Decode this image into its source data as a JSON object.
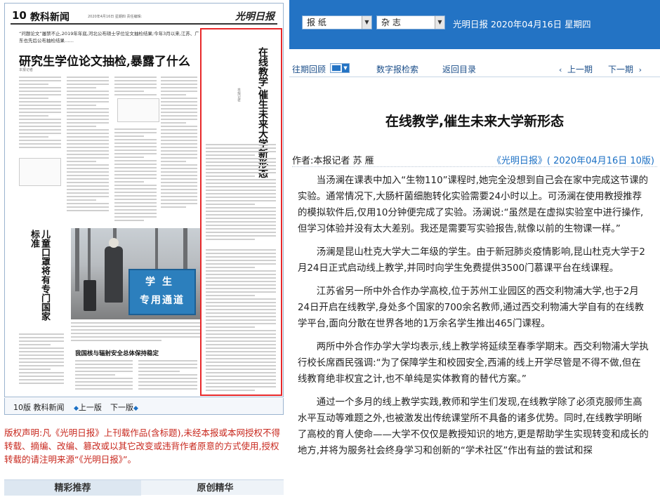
{
  "newspaper": {
    "page_number": "10",
    "section": "教科新闻",
    "date_line": "2020年4月16日 星期四 责任编辑:",
    "logo": "光明日报",
    "lead_text": "“问题论文”屡禁不止,2019年年底,河北公布硕士学位论文抽检结果;今年3月以来,江苏、广东也先后公布抽检结果……",
    "headline": "研究生学位论文抽检,暴露了什么",
    "highlight_title": "在线教学,催生未来大学新形态",
    "side_title": "儿童口罩将有专门国家标准",
    "photo_sign_line1": "学生",
    "photo_sign_line2": "专用通道",
    "sub_headline": "我国核与辐射安全总体保持稳定"
  },
  "page_nav": {
    "current": "10版 教科新闻",
    "prev": "上一版",
    "next": "下一版"
  },
  "copyright": "版权声明:凡《光明日报》上刊载作品(含标题),未经本报或本网授权不得转载、摘编、改编、篡改或以其它改变或违背作者原意的方式使用,授权转载的请注明来源“《光明日报》”。",
  "tabs": [
    "精彩推荐",
    "原创精华"
  ],
  "topbar": {
    "select_1": "报 纸",
    "select_2": "杂 志",
    "paper_date": "光明日报 2020年04月16日 星期四"
  },
  "navbar": {
    "archive": "往期回顾",
    "digital_search": "数字报检索",
    "back_to_index": "返回目录",
    "prev_page": "上一期",
    "next_page": "下一期"
  },
  "article": {
    "title": "在线教学,催生未来大学新形态",
    "author": "作者:本报记者 苏 雁",
    "source": "《光明日报》( 2020年04月16日 10版)",
    "paragraphs": [
      "当汤澜在课表中加入“生物110”课程时,她完全没想到自己会在家中完成这节课的实验。通常情况下,大肠杆菌细胞转化实验需要24小时以上。可汤澜在使用教授推荐的模拟软件后,仅用10分钟便完成了实验。汤澜说:“虽然是在虚拟实验室中进行操作,但学习体验并没有太大差别。我还是需要写实验报告,就像以前的生物课一样。”",
      "汤澜是昆山杜克大学大二年级的学生。由于新冠肺炎疫情影响,昆山杜克大学于2月24日正式启动线上教学,并同时向学生免费提供3500门慕课平台在线课程。",
      "江苏省另一所中外合作办学高校,位于苏州工业园区的西交利物浦大学,也于2月24日开启在线教学,身处多个国家的700余名教师,通过西交利物浦大学自有的在线教学平台,面向分散在世界各地的1万余名学生推出465门课程。",
      "两所中外合作办学大学均表示,线上教学将延续至春季学期末。西交利物浦大学执行校长席酉民强调:“为了保障学生和校园安全,西浦的线上开学尽管是不得不做,但在线教育绝非权宜之计,也不单纯是实体教育的替代方案。”",
      "通过一个多月的线上教学实践,教师和学生们发现,在线教学除了必须克服师生高水平互动等难题之外,也被激发出传统课堂所不具备的诸多优势。同时,在线教学明晰了高校的育人使命——大学不仅仅是教授知识的地方,更是帮助学生实现转变和成长的地方,并将为服务社会终身学习和创新的“学术社区”作出有益的尝试和探"
    ]
  },
  "colors": {
    "topbar_blue": "#2373c4",
    "highlight_red": "#e8282a",
    "copyright_red": "#c8281e",
    "link_blue": "#1a6fc4"
  },
  "icons": {
    "page_prev": "left-triangle-icon",
    "page_next": "right-triangle-icon",
    "select_arrow": "chevron-down-icon",
    "layout_switch": "layout-icon"
  }
}
